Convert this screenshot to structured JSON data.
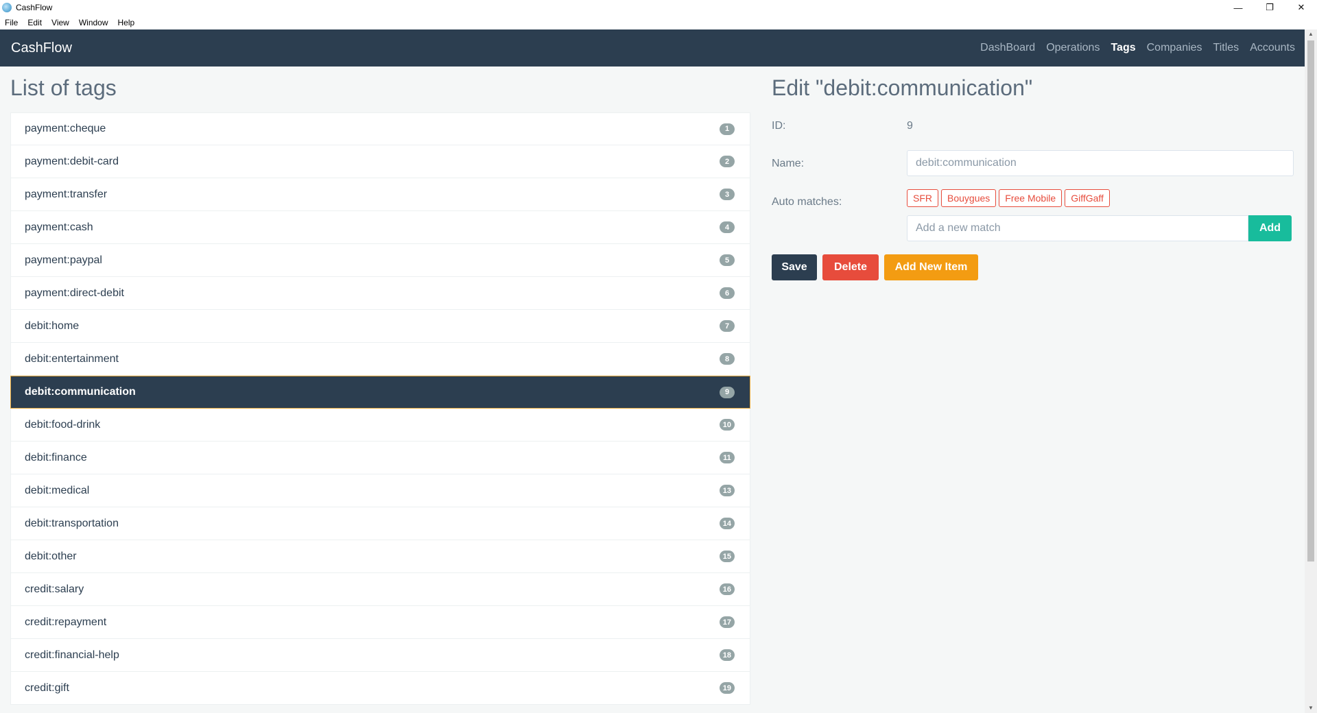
{
  "window": {
    "title": "CashFlow",
    "minimize": "—",
    "maximize": "❐",
    "close": "✕"
  },
  "menu": {
    "items": [
      "File",
      "Edit",
      "View",
      "Window",
      "Help"
    ]
  },
  "navbar": {
    "brand": "CashFlow",
    "links": [
      "DashBoard",
      "Operations",
      "Tags",
      "Companies",
      "Titles",
      "Accounts"
    ],
    "active": "Tags"
  },
  "list": {
    "title": "List of tags",
    "items": [
      {
        "label": "payment:cheque",
        "badge": "1"
      },
      {
        "label": "payment:debit-card",
        "badge": "2"
      },
      {
        "label": "payment:transfer",
        "badge": "3"
      },
      {
        "label": "payment:cash",
        "badge": "4"
      },
      {
        "label": "payment:paypal",
        "badge": "5"
      },
      {
        "label": "payment:direct-debit",
        "badge": "6"
      },
      {
        "label": "debit:home",
        "badge": "7"
      },
      {
        "label": "debit:entertainment",
        "badge": "8"
      },
      {
        "label": "debit:communication",
        "badge": "9"
      },
      {
        "label": "debit:food-drink",
        "badge": "10"
      },
      {
        "label": "debit:finance",
        "badge": "11"
      },
      {
        "label": "debit:medical",
        "badge": "13"
      },
      {
        "label": "debit:transportation",
        "badge": "14"
      },
      {
        "label": "debit:other",
        "badge": "15"
      },
      {
        "label": "credit:salary",
        "badge": "16"
      },
      {
        "label": "credit:repayment",
        "badge": "17"
      },
      {
        "label": "credit:financial-help",
        "badge": "18"
      },
      {
        "label": "credit:gift",
        "badge": "19"
      }
    ],
    "selected_index": 8
  },
  "edit": {
    "title": "Edit \"debit:communication\"",
    "id_label": "ID:",
    "id_value": "9",
    "name_label": "Name:",
    "name_value": "debit:communication",
    "auto_label": "Auto matches:",
    "matches": [
      "SFR",
      "Bouygues",
      "Free Mobile",
      "GiffGaff"
    ],
    "match_placeholder": "Add a new match",
    "add_label": "Add",
    "save_label": "Save",
    "delete_label": "Delete",
    "new_label": "Add New Item"
  }
}
